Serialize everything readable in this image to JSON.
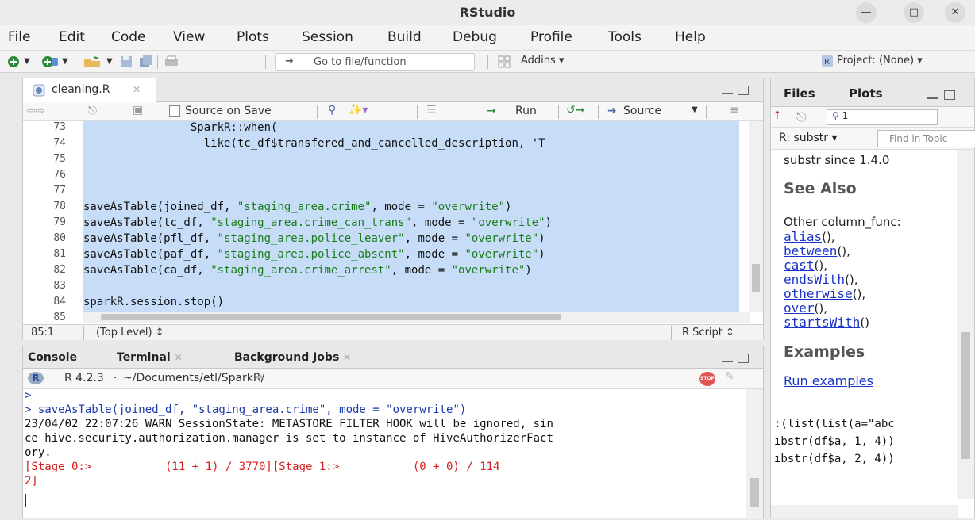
{
  "window": {
    "title": "RStudio"
  },
  "menu": [
    "File",
    "Edit",
    "Code",
    "View",
    "Plots",
    "Session",
    "Build",
    "Debug",
    "Profile",
    "Tools",
    "Help"
  ],
  "toolbar": {
    "goto_placeholder": "Go to file/function",
    "addins": "Addins ▾",
    "project": "Project: (None) ▾"
  },
  "editor": {
    "tab_label": "cleaning.R",
    "source_on_save": "Source on Save",
    "run": "Run",
    "source": "Source",
    "line_numbers": [
      "73",
      "74",
      "75",
      "76",
      "77",
      "78",
      "79",
      "80",
      "81",
      "82",
      "83",
      "84",
      "85"
    ],
    "lines": [
      {
        "code": "                SparkR::when("
      },
      {
        "code": "                  like(tc_df$transfered_and_cancelled_description, 'T"
      },
      {
        "code": ""
      },
      {
        "code": ""
      },
      {
        "code": ""
      },
      {
        "pre": "saveAsTable(joined_df, ",
        "str1": "\"staging_area.crime\"",
        "mid": ", mode = ",
        "str2": "\"overwrite\"",
        "post": ")"
      },
      {
        "pre": "saveAsTable(tc_df, ",
        "str1": "\"staging_area.crime_can_trans\"",
        "mid": ", mode = ",
        "str2": "\"overwrite\"",
        "post": ")"
      },
      {
        "pre": "saveAsTable(pfl_df, ",
        "str1": "\"staging_area.police_leaver\"",
        "mid": ", mode = ",
        "str2": "\"overwrite\"",
        "post": ")"
      },
      {
        "pre": "saveAsTable(paf_df, ",
        "str1": "\"staging_area.police_absent\"",
        "mid": ", mode = ",
        "str2": "\"overwrite\"",
        "post": ")"
      },
      {
        "pre": "saveAsTable(ca_df, ",
        "str1": "\"staging_area.crime_arrest\"",
        "mid": ", mode = ",
        "str2": "\"overwrite\"",
        "post": ")"
      },
      {
        "code": ""
      },
      {
        "code": "sparkR.session.stop()"
      },
      {
        "code": ""
      }
    ],
    "status_pos": "85:1",
    "status_scope": "(Top Level) ↕",
    "status_type": "R Script ↕"
  },
  "console": {
    "tabs": [
      "Console",
      "Terminal",
      "Background Jobs"
    ],
    "r_version": "R 4.2.3",
    "path": "~/Documents/etl/SparkR/",
    "lines": [
      ">",
      "> saveAsTable(joined_df, \"staging_area.crime\", mode = \"overwrite\")",
      "23/04/02 22:07:26 WARN SessionState: METASTORE_FILTER_HOOK will be ignored, sin",
      "ce hive.security.authorization.manager is set to instance of HiveAuthorizerFact",
      "ory.",
      "[Stage 0:>           (11 + 1) / 3770][Stage 1:>           (0 + 0) / 114",
      "2]"
    ]
  },
  "help": {
    "tabs": [
      "Files",
      "Plots"
    ],
    "search_value": "1",
    "topic_select": "R: substr ▾",
    "find_placeholder": "Find in Topic",
    "since": "substr since 1.4.0",
    "see_also": "See Also",
    "other": "Other column_func:",
    "links": [
      "alias",
      "between",
      "cast",
      "endsWith",
      "otherwise",
      "over",
      "startsWith"
    ],
    "link_suffixes": [
      "(),",
      "(),",
      "(),",
      "(),",
      "(),",
      "(),",
      "()"
    ],
    "examples": "Examples",
    "run_examples": "Run examples",
    "code": [
      ":(list(list(a=\"abc",
      "ıbstr(df$a, 1, 4))",
      "ıbstr(df$a, 2, 4))"
    ]
  }
}
